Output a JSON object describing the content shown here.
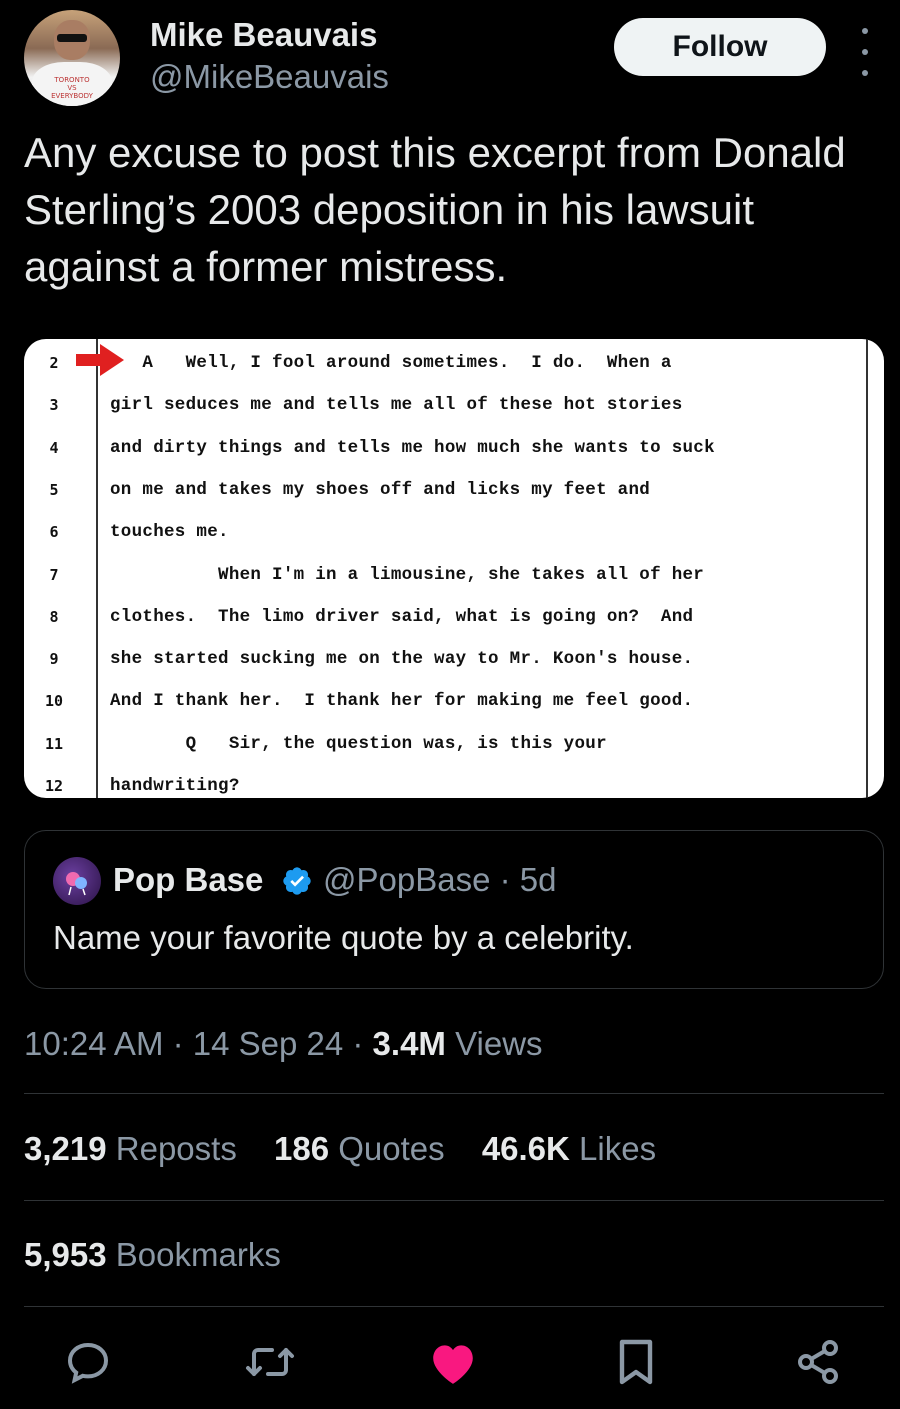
{
  "author": {
    "name": "Mike Beauvais",
    "handle": "@MikeBeauvais",
    "avatar_shirt_text": "TORONTO VS EVERYBODY",
    "follow_label": "Follow"
  },
  "tweet": {
    "text": "Any excuse to post this excerpt from Donald Sterling’s 2003 deposition in his lawsuit against a former mistress."
  },
  "transcript": {
    "lines": [
      {
        "num": "2",
        "text": "   A   Well, I fool around sometimes.  I do.  When a"
      },
      {
        "num": "3",
        "text": "girl seduces me and tells me all of these hot stories"
      },
      {
        "num": "4",
        "text": "and dirty things and tells me how much she wants to suck"
      },
      {
        "num": "5",
        "text": "on me and takes my shoes off and licks my feet and"
      },
      {
        "num": "6",
        "text": "touches me."
      },
      {
        "num": "7",
        "text": "          When I'm in a limousine, she takes all of her"
      },
      {
        "num": "8",
        "text": "clothes.  The limo driver said, what is going on?  And"
      },
      {
        "num": "9",
        "text": "she started sucking me on the way to Mr. Koon's house."
      },
      {
        "num": "10",
        "text": "And I thank her.  I thank her for making me feel good."
      },
      {
        "num": "11",
        "text": "       Q   Sir, the question was, is this your"
      },
      {
        "num": "12",
        "text": "handwriting?"
      }
    ]
  },
  "quoted": {
    "name": "Pop Base",
    "handle_time": "@PopBase · 5d",
    "text": "Name your favorite quote by a celebrity."
  },
  "meta": {
    "time_date": "10:24 AM · 14 Sep 24 · ",
    "views_count": "3.4M",
    "views_label": " Views"
  },
  "stats": {
    "reposts_count": "3,219",
    "reposts_label": "Reposts",
    "quotes_count": "186",
    "quotes_label": "Quotes",
    "likes_count": "46.6K",
    "likes_label": "Likes",
    "bookmarks_count": "5,953",
    "bookmarks_label": "Bookmarks"
  },
  "colors": {
    "background": "#000000",
    "text_primary": "#e7e9ea",
    "text_secondary": "#8b98a5",
    "like_active": "#f91880",
    "verified": "#1d9bf0",
    "arrow": "#e02020"
  },
  "icons": [
    "reply-icon",
    "repost-icon",
    "like-icon",
    "bookmark-icon",
    "share-icon",
    "more-icon",
    "verified-badge-icon"
  ]
}
